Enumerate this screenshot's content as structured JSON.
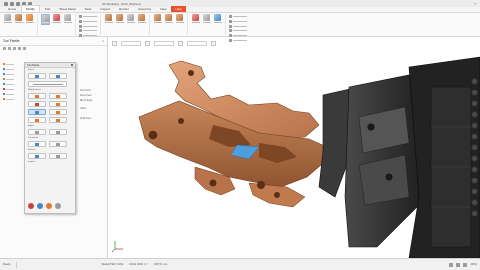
{
  "window": {
    "title": "3D Modeling - [Part_Bracket]",
    "help_label": "?"
  },
  "ribbon": {
    "tabs": [
      "Home",
      "Modify",
      "Part",
      "Sheet Metal",
      "Tools",
      "Inspect",
      "Render",
      "Assembly",
      "View",
      "Help"
    ],
    "active_tab": "Modify",
    "highlight_tab": "Help"
  },
  "left_panel": {
    "title": "Tool Palette",
    "close_label": "×",
    "tree_notes": [
      "Part Tools",
      "Move Face",
      "Blend Edge",
      "Offset",
      "Draft Face"
    ]
  },
  "palette": {
    "title": "Tool Palette",
    "sections": [
      "Faces",
      "Modify Faces",
      "Edges",
      "Transform",
      "Surface",
      "Inspect"
    ]
  },
  "status_bar": {
    "left": "Ready",
    "mid": [
      "SELECTED:  FACE",
      "FACE SIZE: 1.7",
      "UNITS: mm"
    ],
    "right_label": "100%"
  },
  "colors": {
    "part_copper": "#c8865a",
    "part_shadow": "#8f5530",
    "gripper_dark": "#2a2a2a",
    "selection_blue": "#4d9fdc",
    "ribbon_accent": "#e8522a"
  }
}
